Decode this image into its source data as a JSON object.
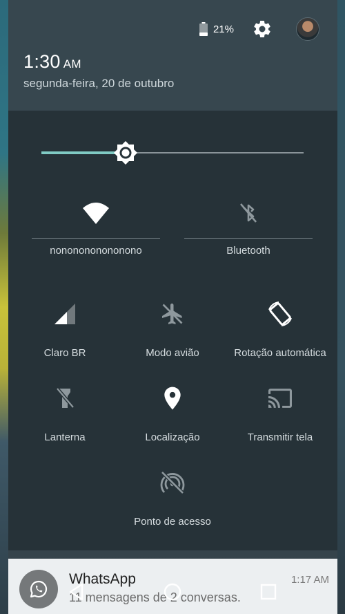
{
  "status": {
    "battery": "21%"
  },
  "header": {
    "time": "1:30",
    "ampm": "AM",
    "date": "segunda-feira, 20 de outubro"
  },
  "brightness": {
    "level_fraction": 0.32
  },
  "tiles": {
    "wifi": "nononononononono",
    "bluetooth": "Bluetooth",
    "mobile": "Claro BR",
    "airplane": "Modo avião",
    "rotation": "Rotação automática",
    "flashlight": "Lanterna",
    "location": "Localização",
    "cast": "Transmitir tela",
    "hotspot": "Ponto de acesso"
  },
  "notification": {
    "app": "WhatsApp",
    "message": "11 mensagens de 2 conversas.",
    "time": "1:17 AM"
  },
  "colors": {
    "panel": "#263238",
    "header": "#37474f",
    "accent": "#80cbc4"
  }
}
